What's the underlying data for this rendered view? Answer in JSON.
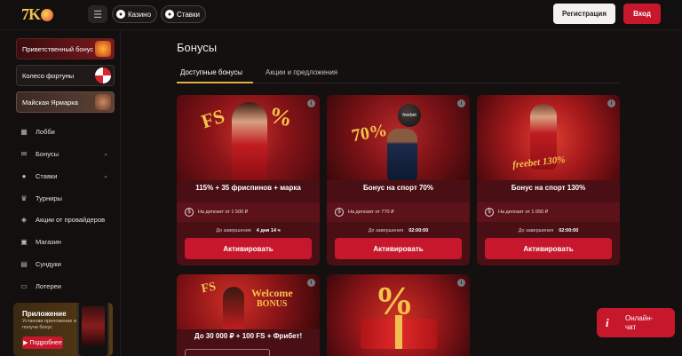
{
  "header": {
    "logo_text": "7K",
    "menu_icon": "menu-toggle-icon",
    "nav_pills": [
      {
        "label": "Казино",
        "icon": "soccer-ball-icon"
      },
      {
        "label": "Ставки",
        "icon": "soccer-ball-icon"
      }
    ],
    "register_label": "Регистрация",
    "login_label": "Вход"
  },
  "sidebar": {
    "promos": [
      {
        "label": "Приветственный бонус"
      },
      {
        "label": "Колесо фортуны"
      },
      {
        "label": "Майская Ярмарка"
      }
    ],
    "items": [
      {
        "label": "Лобби",
        "icon": "lobby-icon"
      },
      {
        "label": "Бонусы",
        "icon": "gift-icon",
        "expandable": true
      },
      {
        "label": "Ставки",
        "icon": "ball-icon",
        "expandable": true
      },
      {
        "label": "Турниры",
        "icon": "trophy-icon"
      },
      {
        "label": "Акции от провайдеров",
        "icon": "tag-icon"
      },
      {
        "label": "Магазин",
        "icon": "shop-icon"
      },
      {
        "label": "Сундуки",
        "icon": "chest-icon"
      },
      {
        "label": "Лотереи",
        "icon": "ticket-icon"
      }
    ],
    "app": {
      "title": "Приложение",
      "subtitle": "Установи приложение и получи бонус",
      "button_label": "Подробнее"
    }
  },
  "main": {
    "title": "Бонусы",
    "tabs": [
      {
        "label": "Доступные бонусы",
        "active": true
      },
      {
        "label": "Акции и предложения",
        "active": false
      }
    ],
    "cards": [
      {
        "title": "115% + 35 фриспинов + марка",
        "deposit": "На депозит от 1 500 ₽",
        "remaining_label": "До завершения",
        "remaining_value": "4 дня  14 ч",
        "button": "Активировать"
      },
      {
        "title": "Бонус на спорт 70%",
        "deposit": "На депозит от 770 ₽",
        "remaining_label": "До завершения",
        "remaining_value": "02:00:00",
        "button": "Активировать"
      },
      {
        "title": "Бонус на спорт 130%",
        "deposit": "На депозит от 1 050 ₽",
        "remaining_label": "До завершения",
        "remaining_value": "02:00:00",
        "button": "Активировать"
      },
      {
        "title": "До 30 000 ₽ + 100 FS + Фрибет!"
      },
      {
        "title": ""
      }
    ],
    "image_texts": {
      "fs": "FS",
      "percent": "%",
      "seventy": "70%",
      "freebet_ball": "freebet",
      "freebet_banner": "freebet 130%",
      "welcome": "Welcome",
      "bonus": "BONUS"
    }
  },
  "chat": {
    "icon": "info-icon",
    "label_line1": "Онлайн-",
    "label_line2": "чат"
  },
  "colors": {
    "accent_red": "#c7172c",
    "gold": "#e0b040",
    "background": "#141010"
  }
}
